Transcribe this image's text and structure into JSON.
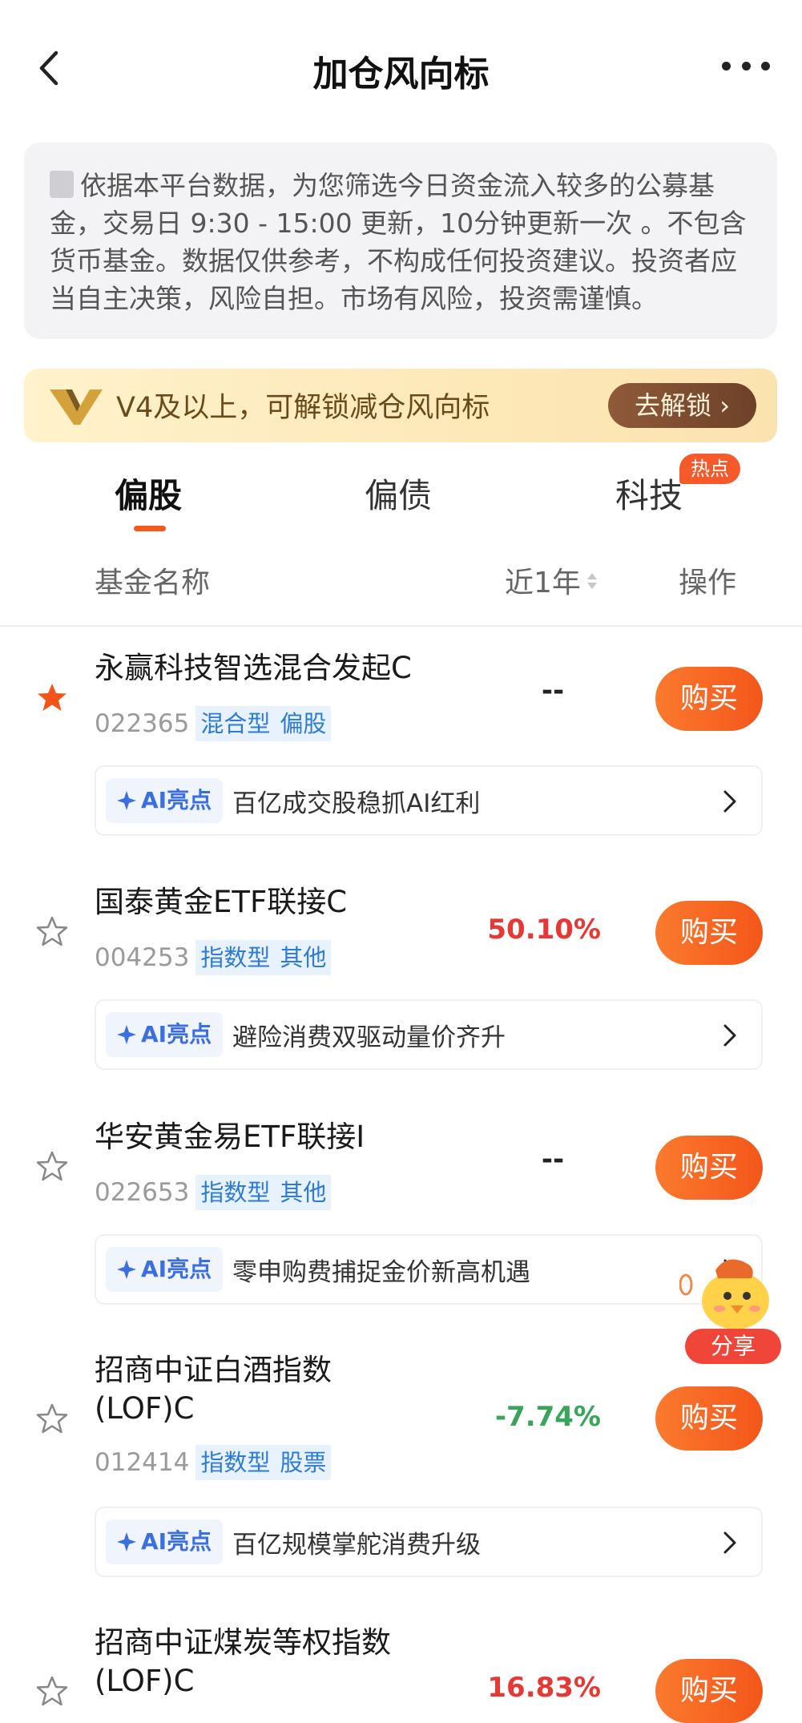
{
  "header": {
    "title": "加仓风向标"
  },
  "notice": {
    "text": "依据本平台数据，为您筛选今日资金流入较多的公募基金，交易日 9:30 - 15:00 更新，10分钟更新一次 。不包含货币基金。数据仅供参考，不构成任何投资建议。投资者应当自主决策，风险自担。市场有风险，投资需谨慎。"
  },
  "vip_banner": {
    "text": "V4及以上，可解锁减仓风向标",
    "button": "去解锁"
  },
  "tabs": [
    {
      "label": "偏股",
      "active": true
    },
    {
      "label": "偏债",
      "active": false
    },
    {
      "label": "科技",
      "active": false,
      "badge": "热点"
    }
  ],
  "table_header": {
    "name": "基金名称",
    "period": "近1年",
    "action": "操作"
  },
  "funds": [
    {
      "name": "永赢科技智选混合发起C",
      "code": "022365",
      "tags": [
        "混合型",
        "偏股"
      ],
      "return": "--",
      "starred": true,
      "button": "购买",
      "ai_label": "AI亮点",
      "ai_text": "百亿成交股稳抓AI红利"
    },
    {
      "name": "国泰黄金ETF联接C",
      "code": "004253",
      "tags": [
        "指数型",
        "其他"
      ],
      "return": "50.10%",
      "starred": false,
      "button": "购买",
      "ai_label": "AI亮点",
      "ai_text": "避险消费双驱动量价齐升"
    },
    {
      "name": "华安黄金易ETF联接I",
      "code": "022653",
      "tags": [
        "指数型",
        "其他"
      ],
      "return": "--",
      "starred": false,
      "button": "购买",
      "ai_label": "AI亮点",
      "ai_text": "零申购费捕捉金价新高机遇"
    },
    {
      "name_line1": "招商中证白酒指数",
      "name_line2": "(LOF)C",
      "code": "012414",
      "tags": [
        "指数型",
        "股票"
      ],
      "return": "-7.74%",
      "starred": false,
      "button": "购买",
      "ai_label": "AI亮点",
      "ai_text": "百亿规模掌舵消费升级"
    },
    {
      "name_line1": "招商中证煤炭等权指数",
      "name_line2": "(LOF)C",
      "return": "16.83%",
      "starred": false,
      "button": "购买"
    }
  ],
  "floating": {
    "share": "分享"
  },
  "colors": {
    "accent": "#f45a1e",
    "positive": "#e53935",
    "negative": "#3aa45a",
    "tag_bg": "#e7f2fd",
    "tag_text": "#2f7bd4"
  }
}
